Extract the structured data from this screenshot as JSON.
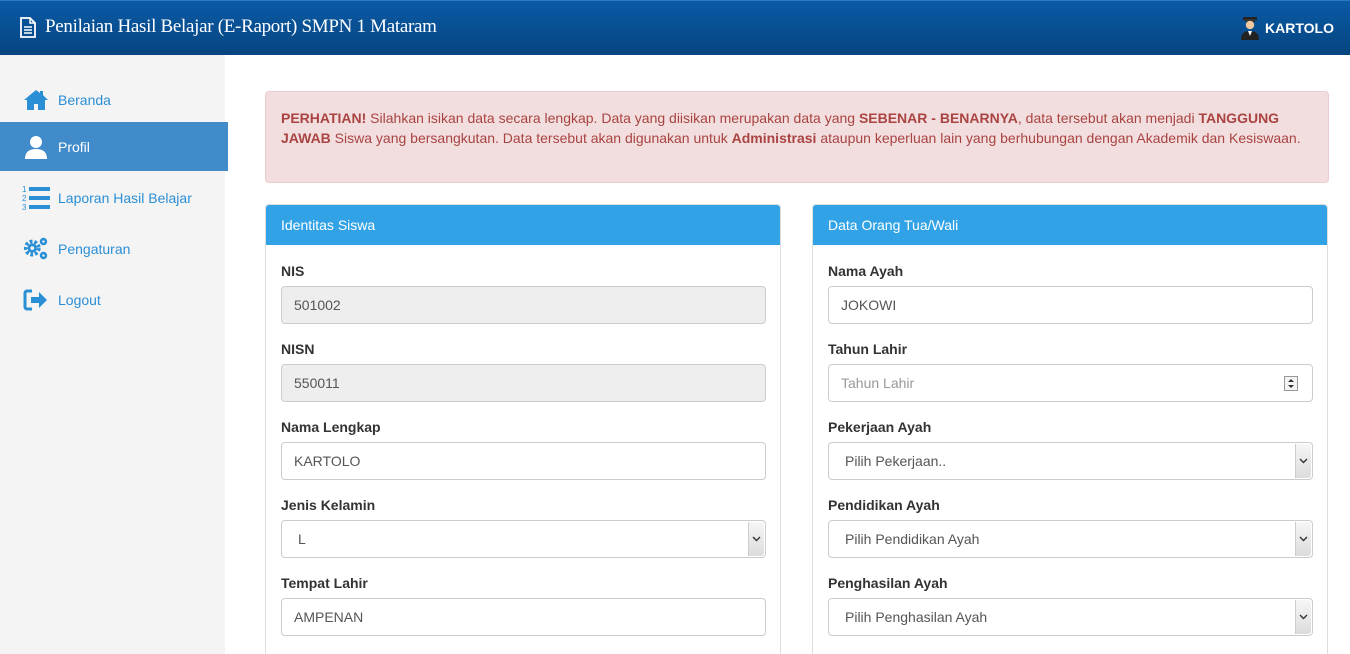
{
  "header": {
    "title": "Penilaian Hasil Belajar (E-Raport) SMPN 1 Mataram",
    "user": "KARTOLO",
    "icons": [
      "document-icon",
      "user-avatar-icon"
    ]
  },
  "sidebar": {
    "items": [
      {
        "label": "Beranda",
        "icon": "home-icon"
      },
      {
        "label": "Profil",
        "icon": "user-icon",
        "active": true
      },
      {
        "label": "Laporan Hasil Belajar",
        "icon": "numbered-list-icon"
      },
      {
        "label": "Pengaturan",
        "icon": "gears-icon"
      },
      {
        "label": "Logout",
        "icon": "sign-out-icon"
      }
    ]
  },
  "alert": {
    "p1_bold": "PERHATIAN!",
    "p1": " Silahkan isikan data secara lengkap. Data yang diisikan merupakan data yang ",
    "p2_bold": "SEBENAR - BENARNYA",
    "p2": ", data tersebut akan menjadi ",
    "p3_bold": "TANGGUNG JAWAB",
    "p3": " Siswa yang bersangkutan. Data tersebut akan digunakan untuk ",
    "p4_bold": "Administrasi",
    "p4": " ataupun keperluan lain yang berhubungan dengan Akademik dan Kesiswaan."
  },
  "panel_siswa": {
    "title": "Identitas Siswa",
    "nis_label": "NIS",
    "nis_value": "501002",
    "nisn_label": "NISN",
    "nisn_value": "550011",
    "nama_label": "Nama Lengkap",
    "nama_value": "KARTOLO",
    "jk_label": "Jenis Kelamin",
    "jk_value": "L",
    "tempat_label": "Tempat Lahir",
    "tempat_value": "AMPENAN"
  },
  "panel_ortu": {
    "title": "Data Orang Tua/Wali",
    "nama_ayah_label": "Nama Ayah",
    "nama_ayah_value": "JOKOWI",
    "tahun_label": "Tahun Lahir",
    "tahun_placeholder": "Tahun Lahir",
    "pekerjaan_label": "Pekerjaan Ayah",
    "pekerjaan_value": "Pilih Pekerjaan..",
    "pendidikan_label": "Pendidikan Ayah",
    "pendidikan_value": "Pilih Pendidikan Ayah",
    "penghasilan_label": "Penghasilan Ayah",
    "penghasilan_value": "Pilih Penghasilan Ayah"
  },
  "colors": {
    "navbar": "#06457f",
    "active": "#428bca",
    "panel_header": "#31a2e6",
    "link": "#2b8fd6"
  }
}
